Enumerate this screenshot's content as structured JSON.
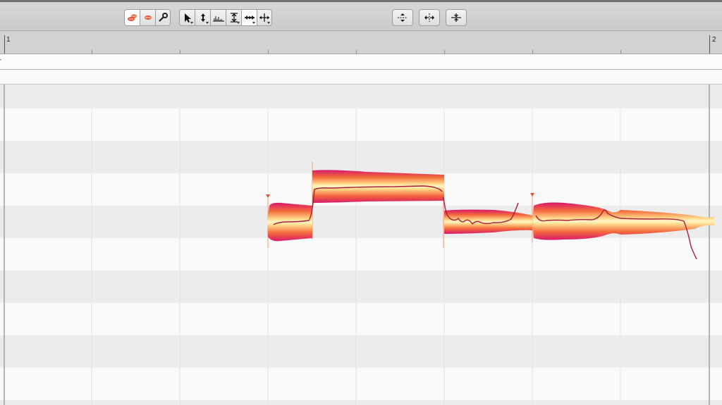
{
  "toolbar": {
    "left_group": [
      {
        "icon": "blob-macro-icon",
        "active": true
      },
      {
        "icon": "blob-icon",
        "active": false
      },
      {
        "icon": "wrench-icon",
        "active": false
      }
    ],
    "tool_group": [
      {
        "icon": "pointer-tool-icon",
        "dropdown": true,
        "active": false
      },
      {
        "icon": "pitch-tool-icon",
        "dropdown": true,
        "active": false
      },
      {
        "icon": "formant-tool-icon",
        "dropdown": false,
        "active": false
      },
      {
        "icon": "amplitude-tool-icon",
        "dropdown": true,
        "active": false
      },
      {
        "icon": "time-tool-icon",
        "dropdown": true,
        "active": true
      },
      {
        "icon": "separation-tool-icon",
        "dropdown": true,
        "active": false
      }
    ],
    "right_buttons": [
      {
        "icon": "quantize-pitch-icon"
      },
      {
        "icon": "quantize-time-icon"
      },
      {
        "icon": "level-amplitude-icon"
      }
    ]
  },
  "ruler": {
    "bar_start": "1",
    "bar_end": "2"
  },
  "track": {
    "name_fragment": "r"
  },
  "colors": {
    "note_edge": "#d8196b",
    "note_mid": "#f36a3a",
    "note_core": "#fff6c2",
    "pitch_curve": "#b2223e",
    "lane_light": "#f9f9f9",
    "lane_dark": "#ececec"
  }
}
